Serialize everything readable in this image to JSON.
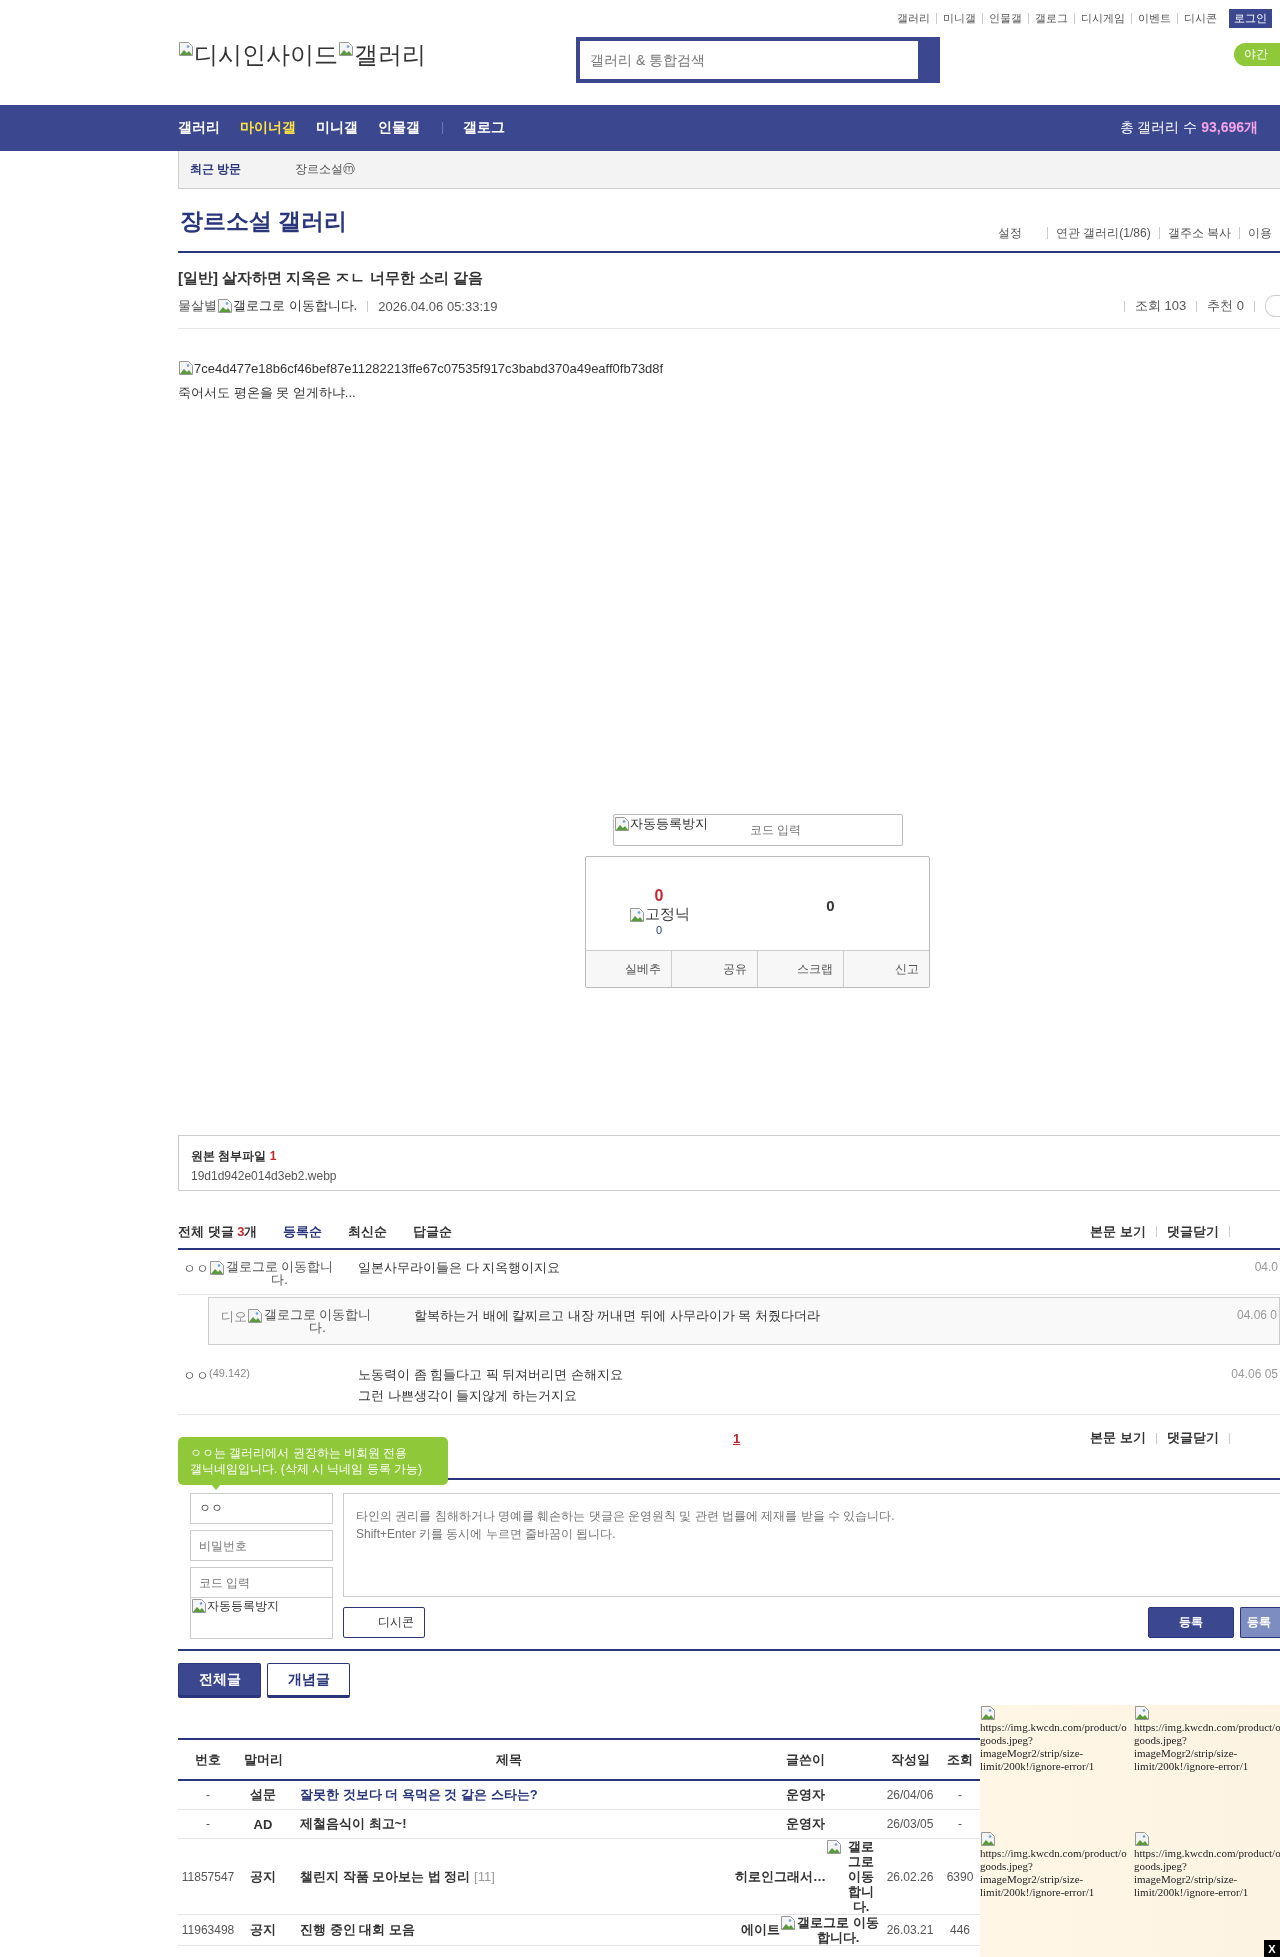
{
  "top_links": [
    "갤러리",
    "미니갤",
    "인물갤",
    "갤로그",
    "디시게임",
    "이벤트",
    "디시콘"
  ],
  "login_button": "로그인",
  "logo": {
    "alt_1": "디시인사이드",
    "alt_2": "갤러리"
  },
  "search": {
    "placeholder": "갤러리 & 통합검색"
  },
  "night_mode_button": "야간",
  "nav": {
    "items": [
      {
        "label": "갤러리",
        "selected": false
      },
      {
        "label": "마이너갤",
        "selected": true
      },
      {
        "label": "미니갤",
        "selected": false
      },
      {
        "label": "인물갤",
        "selected": false
      },
      {
        "label": "갤로그",
        "selected": false
      }
    ],
    "total_label": "총 갤러리 수",
    "total_value": "93,696개"
  },
  "recent": {
    "label": "최근 방문",
    "items": [
      "장르소설ⓜ"
    ]
  },
  "gallery": {
    "title": "장르소설 갤러리",
    "links": [
      "설정",
      "연관 갤러리(1/86)",
      "갤주소 복사",
      "이용"
    ]
  },
  "post": {
    "title": "[일반] 살자하면 지옥은 ㅈㄴ 너무한 소리 같음",
    "author": "물살별",
    "gallog_alt": "갤로그로 이동합니다.",
    "date": "2026.04.06 05:33:19",
    "views": "조회 103",
    "recommends": "추천 0",
    "image_alt": "7ce4d477e18b6cf46bef87e11282213ffe67c07535f917c3babd370a49eaff0fb73d8f",
    "body": "죽어서도 평온을 못 얻게하냐..."
  },
  "captcha": {
    "image_alt": "자동등록방지",
    "placeholder": "코드 입력"
  },
  "vote": {
    "up_count": "0",
    "fixed_nick_alt": "고정닉",
    "fixed_count": "0",
    "down_count": "0",
    "buttons": [
      "실베추",
      "공유",
      "스크랩",
      "신고"
    ]
  },
  "attachment": {
    "label": "원본 첨부파일",
    "count": "1",
    "file": "19d1d942e014d3eb2.webp"
  },
  "comments": {
    "total_label": "전체 댓글",
    "total_count": "3",
    "total_unit": "개",
    "sorts": [
      {
        "label": "등록순",
        "selected": true
      },
      {
        "label": "최신순",
        "selected": false
      },
      {
        "label": "답글순",
        "selected": false
      }
    ],
    "actions": [
      "본문 보기",
      "댓글닫기"
    ],
    "items": [
      {
        "kind": "comment",
        "author": "ㅇㅇ",
        "gallog_alt": "갤로그로 이동합니다.",
        "text": "일본사무라이들은 다 지옥행이지요",
        "date": "04.0"
      },
      {
        "kind": "reply",
        "author": "디오",
        "gallog_alt": "갤로그로 이동합니다.",
        "text": "할복하는거 배에 칼찌르고 내장 꺼내면 뒤에 사무라이가 목 처줬다더라",
        "date": "04.06 0"
      },
      {
        "kind": "comment",
        "author": "ㅇㅇ",
        "ip": "(49.142)",
        "text": "노동력이 좀 힘들다고 픽 뒤져버리면 손해지요\n그런 나쁜생각이 들지않게 하는거지요",
        "date": "04.06 05"
      }
    ],
    "pages": [
      {
        "label": "1",
        "selected": true
      }
    ],
    "actions_bottom": [
      "본문 보기",
      "댓글닫기"
    ]
  },
  "comment_form": {
    "tooltip": "ㅇㅇ는 갤러리에서 권장하는 비회원 전용\n갤닉네임입니다. (삭제 시 닉네임 등록 가능)",
    "name_value": "ㅇㅇ",
    "password_placeholder": "비밀번호",
    "code_placeholder": "코드 입력",
    "captcha_alt": "자동등록방지",
    "textarea_placeholder": "타인의 권리를 침해하거나 명예를 훼손하는 댓글은 운영원칙 및 관련 법률에 제재를 받을 수 있습니다.\nShift+Enter 키를 동시에 누르면 줄바꿈이 됩니다.",
    "dccon_button": "디시콘",
    "submit_buttons": [
      "등록",
      "등록"
    ]
  },
  "list_tabs": [
    {
      "label": "전체글",
      "selected": true
    },
    {
      "label": "개념글",
      "selected": false
    }
  ],
  "table": {
    "columns": [
      "번호",
      "말머리",
      "제목",
      "글쓴이",
      "작성일",
      "조회"
    ],
    "rows": [
      {
        "kind": "survey",
        "number": "-",
        "head": "설문",
        "subject": "잘못한 것보다 더 욕먹은 것 같은 스타는?",
        "writer": "운영자",
        "date": "26/04/06",
        "views": "-"
      },
      {
        "kind": "ad",
        "number": "-",
        "head": "AD",
        "subject": "제철음식이 최고~!",
        "writer": "운영자",
        "date": "26/03/05",
        "views": "-"
      },
      {
        "kind": "notice",
        "number": "11857547",
        "head": "공지",
        "subject": "챌린지 작품 모아보는 법 정리",
        "reply_count": "[11]",
        "writer": "히로인그래서…",
        "writer_alt": "갤로그로 이동합니다.",
        "date": "26.02.26",
        "views": "6390"
      },
      {
        "kind": "notice",
        "number": "11963498",
        "head": "공지",
        "subject": "진행 중인 대회 모음",
        "writer": "에이트",
        "writer_alt": "갤로그로 이동합니다.",
        "date": "26.03.21",
        "views": "446"
      }
    ]
  },
  "ad": {
    "items": [
      "https://img.kwcdn.com/product/o\ngoods.jpeg?\nimageMogr2/strip/size-\nlimit/200k!/ignore-error/1",
      "https://img.kwcdn.com/product/o\ngoods.jpeg?\nimageMogr2/strip/size-\nlimit/200k!/ignore-error/1",
      "https://img.kwcdn.com/product/o\ngoods.jpeg?\nimageMogr2/strip/size-\nlimit/200k!/ignore-error/1",
      "https://img.kwcdn.com/product/o\ngoods.jpeg?\nimageMogr2/strip/size-\nlimit/200k!/ignore-error/1"
    ]
  },
  "close_button": "X"
}
